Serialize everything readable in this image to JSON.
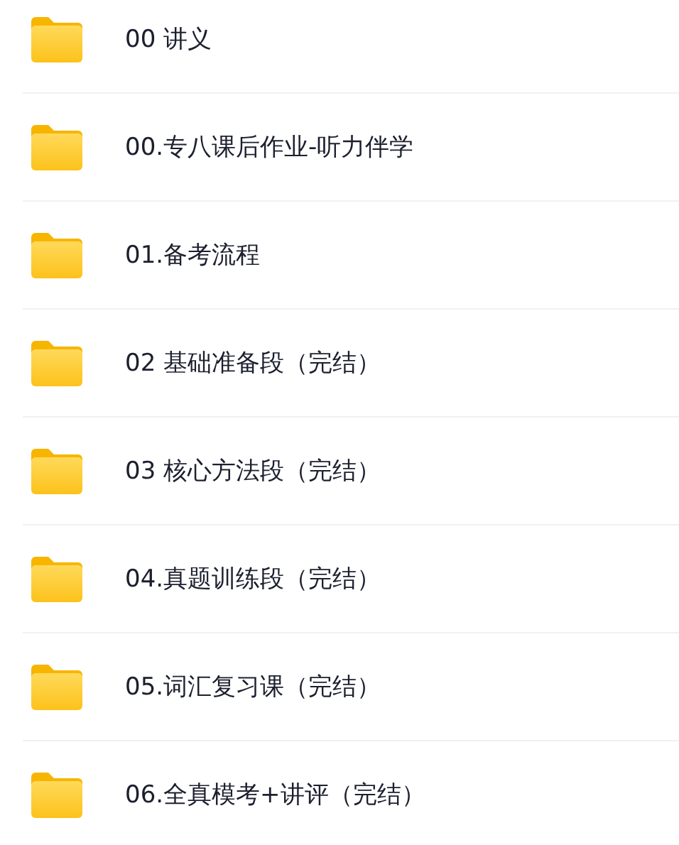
{
  "folders": [
    {
      "name": "00 讲义"
    },
    {
      "name": "00.专八课后作业-听力伴学"
    },
    {
      "name": "01.备考流程"
    },
    {
      "name": "02 基础准备段（完结）"
    },
    {
      "name": "03 核心方法段（完结）"
    },
    {
      "name": "04.真题训练段（完结）"
    },
    {
      "name": "05.词汇复习课（完结）"
    },
    {
      "name": "06.全真模考+讲评（完结）"
    }
  ]
}
